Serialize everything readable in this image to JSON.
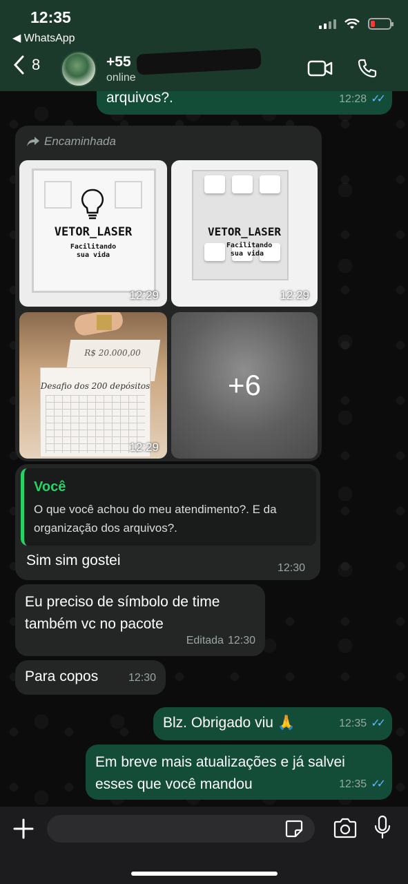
{
  "status_bar": {
    "time": "12:35",
    "back_app": "◀ WhatsApp"
  },
  "header": {
    "unread_count": "8",
    "contact_name": "+55",
    "contact_status": "online"
  },
  "messages": {
    "top_partial": {
      "text": "arquivos?.",
      "time": "12:28"
    },
    "forwarded": {
      "label": "Encaminhada",
      "images": [
        {
          "time": "12:29",
          "brand": "VETOR_LASER",
          "tagline": "Facilitando sua vida"
        },
        {
          "time": "12:29",
          "brand": "VETOR_LASER",
          "tagline": "Facilitando sua vida"
        },
        {
          "time": "12:29",
          "title": "Desafio dos 200 depósitos",
          "subtitle": "R$ 20.000,00"
        },
        {
          "more": "+6"
        }
      ]
    },
    "reply": {
      "quoted_author": "Você",
      "quoted_text": "O que você achou do meu atendimento?. E da organização dos arquivos?.",
      "text": "Sim sim gostei",
      "time": "12:30"
    },
    "msg2": {
      "text": "Eu preciso de símbolo de time também vc no pacote",
      "edited": "Editada",
      "time": "12:30"
    },
    "msg3": {
      "text": "Para copos",
      "time": "12:30"
    },
    "msg4": {
      "text": "Blz. Obrigado viu 🙏",
      "time": "12:35"
    },
    "msg5": {
      "text": "Em breve mais atualizações e já salvei esses que você mandou",
      "time": "12:35"
    }
  },
  "colors": {
    "header_bg": "#1b3a2b",
    "outgoing_bubble": "#144d37",
    "incoming_bubble": "#242626",
    "read_ticks": "#5cb8ff",
    "accent_green": "#25d366"
  },
  "icons": [
    "chevron-left-icon",
    "video-call-icon",
    "phone-icon",
    "forward-icon",
    "plus-icon",
    "sticker-icon",
    "camera-icon",
    "microphone-icon"
  ]
}
